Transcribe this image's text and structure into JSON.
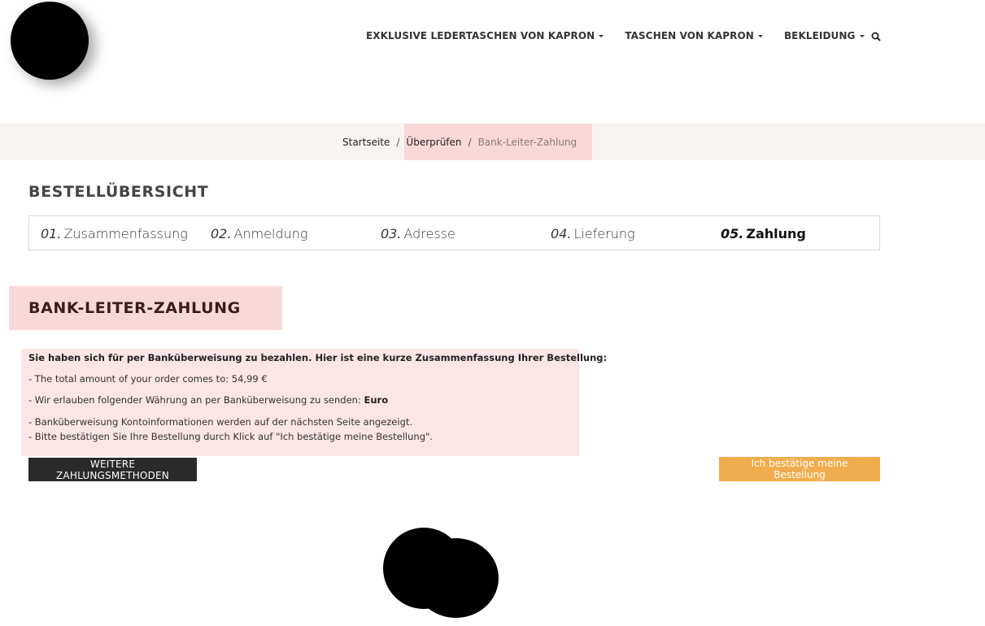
{
  "nav": {
    "items": [
      {
        "label": "EXKLUSIVE LEDERTASCHEN VON KAPRON"
      },
      {
        "label": "TASCHEN VON KAPRON"
      },
      {
        "label": "BEKLEIDUNG"
      }
    ],
    "search_icon": "search-icon"
  },
  "breadcrumb": {
    "home": "Startseite",
    "review": "Überprüfen",
    "current": "Bank-Leiter-Zahlung",
    "separator": "/"
  },
  "page_title": "BESTELLÜBERSICHT",
  "steps": [
    {
      "num": "01.",
      "label": "Zusammenfassung"
    },
    {
      "num": "02.",
      "label": "Anmeldung"
    },
    {
      "num": "03.",
      "label": "Adresse"
    },
    {
      "num": "04.",
      "label": "Lieferung"
    },
    {
      "num": "05.",
      "label": "Zahlung"
    }
  ],
  "section_title": "BANK-LEITER-ZAHLUNG",
  "info": {
    "intro": "Sie haben sich für per Banküberweisung zu bezahlen. Hier ist eine kurze Zusammenfassung Ihrer Bestellung:",
    "amount": "- The total amount of your order comes to: 54,99 €",
    "currency_prefix": "- Wir erlauben folgender Währung an per Banküberweisung zu senden: ",
    "currency": "Euro",
    "account_info": "- Banküberweisung Kontoinformationen werden auf der nächsten Seite angezeigt.",
    "confirm_hint": "- Bitte bestätigen Sie Ihre Bestellung durch Klick auf \"Ich bestätige meine Bestellung\"."
  },
  "buttons": {
    "more_methods": "WEITERE ZAHLUNGSMETHODEN",
    "confirm": "Ich bestätige meine Bestellung"
  },
  "colors": {
    "highlight": "#f9d8d8",
    "accent_orange": "#f0ac4d",
    "dark_button": "#2a2a2a"
  }
}
